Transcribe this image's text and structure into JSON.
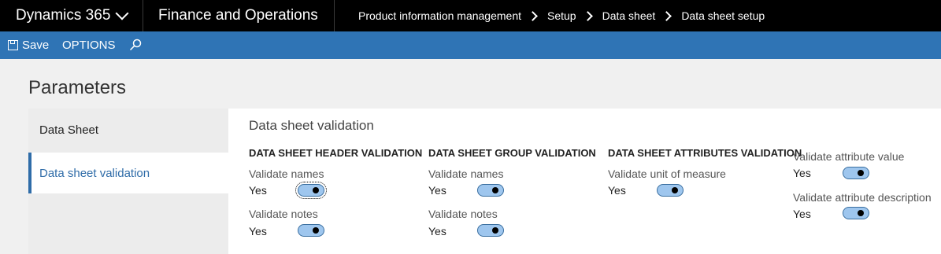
{
  "topbar": {
    "app_name": "Dynamics 365",
    "module": "Finance and Operations",
    "breadcrumb": [
      "Product information management",
      "Setup",
      "Data sheet",
      "Data sheet setup"
    ]
  },
  "actionbar": {
    "save_label": "Save",
    "options_label": "OPTIONS"
  },
  "page": {
    "title": "Parameters"
  },
  "nav": {
    "items": [
      {
        "label": "Data Sheet"
      },
      {
        "label": "Data sheet validation"
      }
    ],
    "selected": "Data sheet validation"
  },
  "content": {
    "section_title": "Data sheet validation",
    "groups": [
      {
        "heading": "DATA SHEET HEADER VALIDATION",
        "fields": [
          {
            "label": "Validate names",
            "value": "Yes"
          },
          {
            "label": "Validate notes",
            "value": "Yes"
          }
        ]
      },
      {
        "heading": "DATA SHEET GROUP VALIDATION",
        "fields": [
          {
            "label": "Validate names",
            "value": "Yes"
          },
          {
            "label": "Validate notes",
            "value": "Yes"
          }
        ]
      },
      {
        "heading": "DATA SHEET ATTRIBUTES VALIDATION",
        "fields": [
          {
            "label": "Validate unit of measure",
            "value": "Yes"
          }
        ]
      },
      {
        "heading": "",
        "fields": [
          {
            "label": "Validate attribute value",
            "value": "Yes"
          },
          {
            "label": "Validate attribute description",
            "value": "Yes"
          }
        ]
      }
    ]
  },
  "colors": {
    "topbar_bg": "#000000",
    "actionbar_bg": "#2f74b5",
    "accent": "#2f6ca8",
    "toggle_on": "#9ec6ee"
  }
}
